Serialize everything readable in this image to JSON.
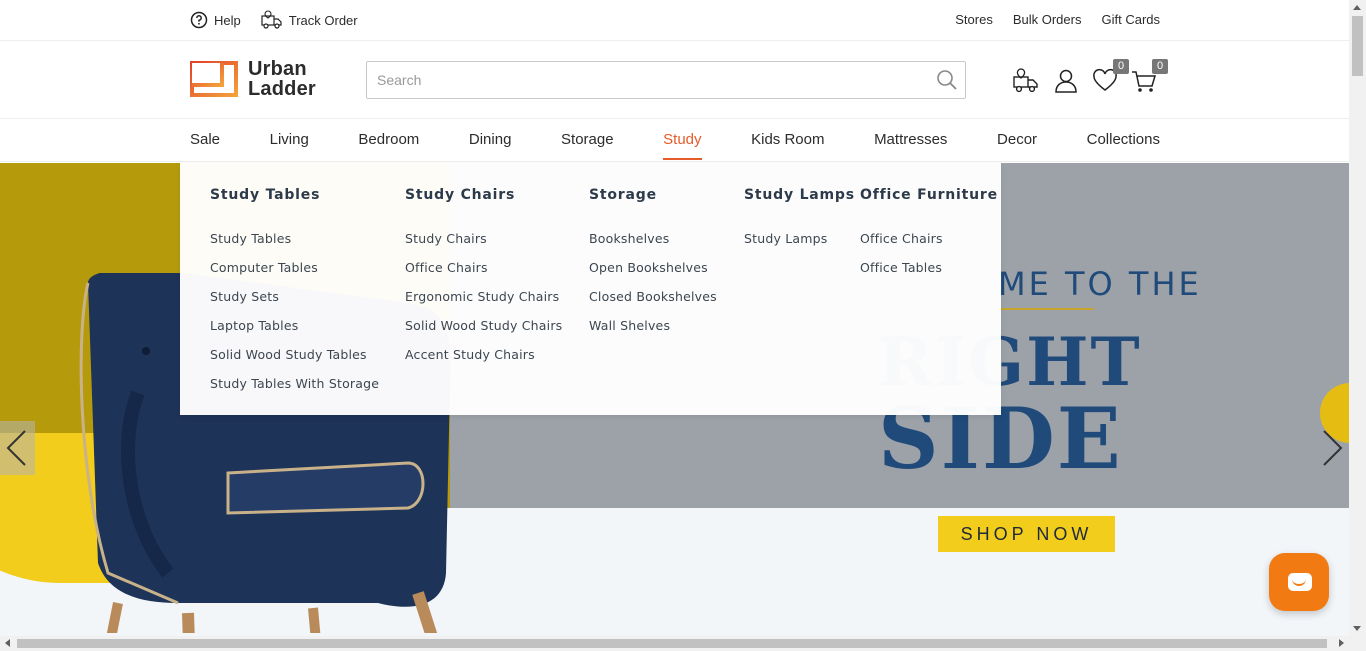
{
  "topbar": {
    "help": "Help",
    "track_order": "Track Order",
    "stores": "Stores",
    "bulk_orders": "Bulk Orders",
    "gift_cards": "Gift Cards"
  },
  "header": {
    "logo_line1": "Urban",
    "logo_line2": "Ladder",
    "search_placeholder": "Search",
    "wishlist_count": "0",
    "cart_count": "0"
  },
  "nav": {
    "items": [
      "Sale",
      "Living",
      "Bedroom",
      "Dining",
      "Storage",
      "Study",
      "Kids Room",
      "Mattresses",
      "Decor",
      "Collections"
    ],
    "active": "Study"
  },
  "mega_menu": {
    "columns": [
      {
        "title": "Study Tables",
        "links": [
          "Study Tables",
          "Computer Tables",
          "Study Sets",
          "Laptop Tables",
          "Solid Wood Study Tables",
          "Study Tables With Storage"
        ]
      },
      {
        "title": "Study Chairs",
        "links": [
          "Study Chairs",
          "Office Chairs",
          "Ergonomic Study Chairs",
          "Solid Wood Study Chairs",
          "Accent Study Chairs"
        ]
      },
      {
        "title": "Storage",
        "links": [
          "Bookshelves",
          "Open Bookshelves",
          "Closed Bookshelves",
          "Wall Shelves"
        ]
      },
      {
        "title": "Study Lamps",
        "links": [
          "Study Lamps"
        ]
      },
      {
        "title": "Office Furniture",
        "links": [
          "Office Chairs",
          "Office Tables"
        ]
      }
    ]
  },
  "hero": {
    "headline_small": "ME TO THE",
    "headline_big1": "RIGHT",
    "headline_big2": "SIDE",
    "cta": "SHOP NOW"
  },
  "colors": {
    "accent": "#e65b2b",
    "hero_navy": "#1f4a7a",
    "hero_yellow": "#f3cd1b",
    "chat": "#f27a12"
  }
}
